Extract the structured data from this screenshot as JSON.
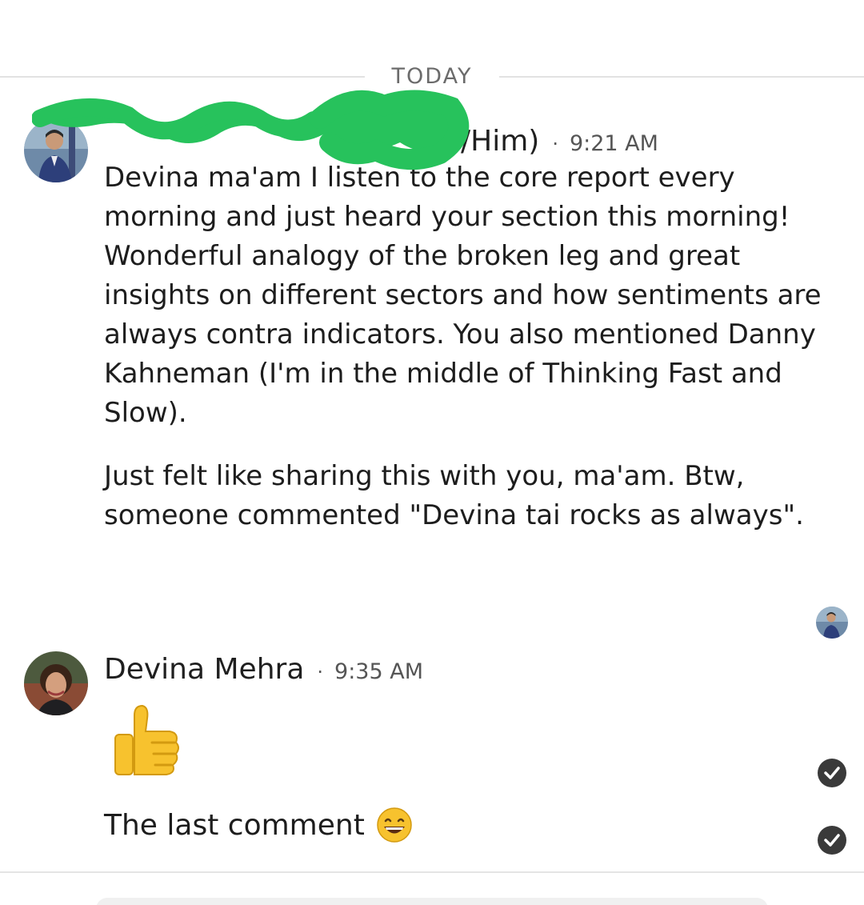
{
  "date_divider": {
    "label": "TODAY"
  },
  "messages": [
    {
      "sender_visible": "(He/Him)",
      "name_partial": "/Him)",
      "time": "9:21 AM",
      "paragraphs": [
        "Devina ma'am I listen to the core report every morning and just heard your section this morning! Wonderful analogy of the broken leg and great insights on different sectors and how sentiments are always contra indicators. You also mentioned Danny Kahneman (I'm in the middle of Thinking Fast and Slow).",
        "Just felt like sharing this with you, ma'am. Btw, someone commented \"Devina tai rocks as always\"."
      ]
    },
    {
      "name": "Devina Mehra",
      "time": "9:35 AM",
      "reaction_emoji": "thumbs-up",
      "text": "The last comment",
      "trailing_emoji": "grinning-face"
    }
  ],
  "status": {
    "read_receipt": "read-receipt-avatar",
    "delivered": "check-circle"
  },
  "separator_dot": "·",
  "colors": {
    "scribble": "#22c55e",
    "check_bg": "#3a3a3a",
    "divider": "#e2e2e2"
  }
}
